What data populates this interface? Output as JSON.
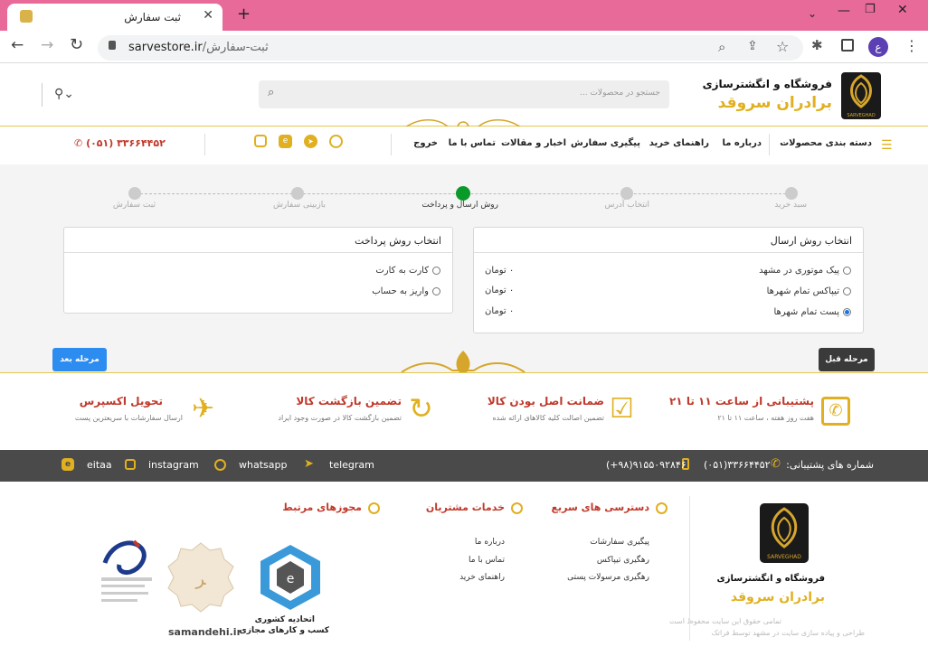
{
  "browser": {
    "tab_title": "ثبت سفارش",
    "url_host": "sarvestore.ir",
    "url_path": "/ثبت-سفارش",
    "profile_letter": "ع"
  },
  "header": {
    "brand_line1": "فروشگاه و انگشترسازی",
    "brand_line2": "برادران سروقد",
    "logo_caption": "SARVEGHAD",
    "search_placeholder": "جستجو در محصولات ..."
  },
  "nav": {
    "categories": "دسته بندی محصولات",
    "items": [
      "درباره ما",
      "راهنمای خرید",
      "پیگیری سفارش",
      "اخبار و مقالات",
      "تماس با ما",
      "خروج"
    ],
    "phone": "(۰۵۱) ۳۳۶۶۴۴۵۲"
  },
  "steps": [
    "سبد خرید",
    "انتخاب آدرس",
    "روش ارسال و پرداخت",
    "بازبینی سفارش",
    "ثبت سفارش"
  ],
  "shipping": {
    "title": "انتخاب روش ارسال",
    "options": [
      {
        "label": "پیک موتوری در مشهد",
        "price": "۰ تومان"
      },
      {
        "label": "تیپاکس تمام شهرها",
        "price": "۰ تومان"
      },
      {
        "label": "پست تمام شهرها",
        "price": "۰ تومان"
      }
    ],
    "selected": 2
  },
  "payment": {
    "title": "انتخاب روش پرداخت",
    "options": [
      "کارت به کارت",
      "واریز به حساب"
    ]
  },
  "buttons": {
    "prev": "مرحله قبل",
    "next": "مرحله بعد"
  },
  "features": [
    {
      "title": "پشتیبانی از ساعت ۱۱ تا ۲۱",
      "sub": "هفت روز هفته ، ساعت ۱۱ تا ۲۱"
    },
    {
      "title": "ضمانت اصل بودن کالا",
      "sub": "تضمین اصالت کلیه کالاهای ارائه شده"
    },
    {
      "title": "تضمین بازگشت کالا",
      "sub": "تضمین بازگشت کالا در صورت وجود ایراد"
    },
    {
      "title": "تحویل اکسپرس",
      "sub": "ارسال سفارشات با سریعترین پست"
    }
  ],
  "support_bar": {
    "label": "شماره های پشتیبانی:",
    "phone1": "(۰۵۱)۳۳۶۶۴۴۵۲",
    "phone2": "(+۹۸)۹۱۵۵۰۹۲۸۴۶",
    "socials": [
      "telegram",
      "whatsapp",
      "instagram",
      "eitaa"
    ]
  },
  "footer": {
    "col_quick": {
      "title": "دسترسی های سریع",
      "links": [
        "پیگیری سفارشات",
        "رهگیری تیپاکس",
        "رهگیری مرسولات پستی"
      ]
    },
    "col_customer": {
      "title": "خدمات مشتریان",
      "links": [
        "درباره ما",
        "تماس با ما",
        "راهنمای خرید"
      ]
    },
    "col_licenses": {
      "title": "مجوزهای مرتبط"
    },
    "union_line1": "اتحادیه کشوری",
    "union_line2": "کسب و کارهای مجازی",
    "samandehi": "samandehi.ir",
    "copyright1": "تمامی حقوق این سایت محفوظ است",
    "copyright2": "طراحی و پیاده سازی سایت در مشهد توسط فراتک"
  },
  "colors": {
    "tabbar": "#e76a98",
    "gold": "#e0b020",
    "accent_red": "#c0392b",
    "next_btn": "#2d8cf0",
    "prev_btn": "#3a3a3a",
    "active_step": "#0a9a2a"
  }
}
